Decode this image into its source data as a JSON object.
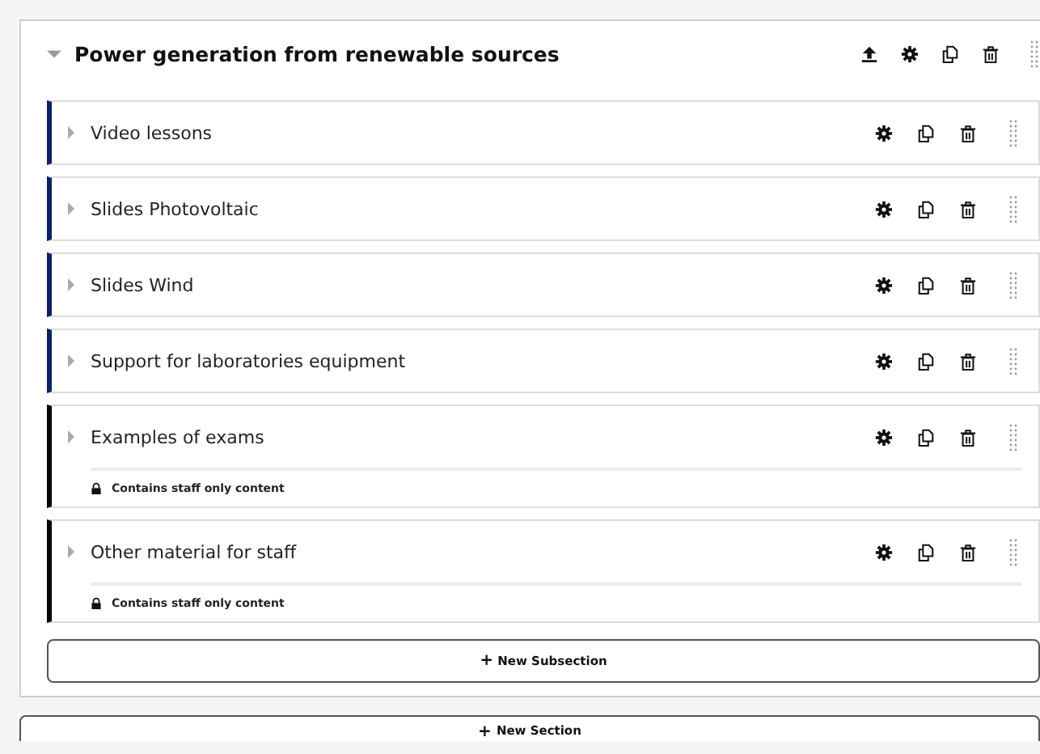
{
  "section": {
    "title": "Power generation from renewable sources",
    "expanded": true,
    "subsections": [
      {
        "title": "Video lessons",
        "expanded": false,
        "staff_only": false
      },
      {
        "title": "Slides Photovoltaic",
        "expanded": false,
        "staff_only": false
      },
      {
        "title": "Slides Wind",
        "expanded": false,
        "staff_only": false
      },
      {
        "title": "Support for laboratories equipment",
        "expanded": false,
        "staff_only": false
      },
      {
        "title": "Examples of exams",
        "expanded": false,
        "staff_only": true,
        "note": "Contains staff only content"
      },
      {
        "title": "Other material for staff",
        "expanded": false,
        "staff_only": true,
        "note": "Contains staff only content"
      }
    ],
    "new_subsection": {
      "icon": "+",
      "label": "New Subsection"
    }
  },
  "new_section": {
    "icon": "+",
    "label": "New Section"
  }
}
